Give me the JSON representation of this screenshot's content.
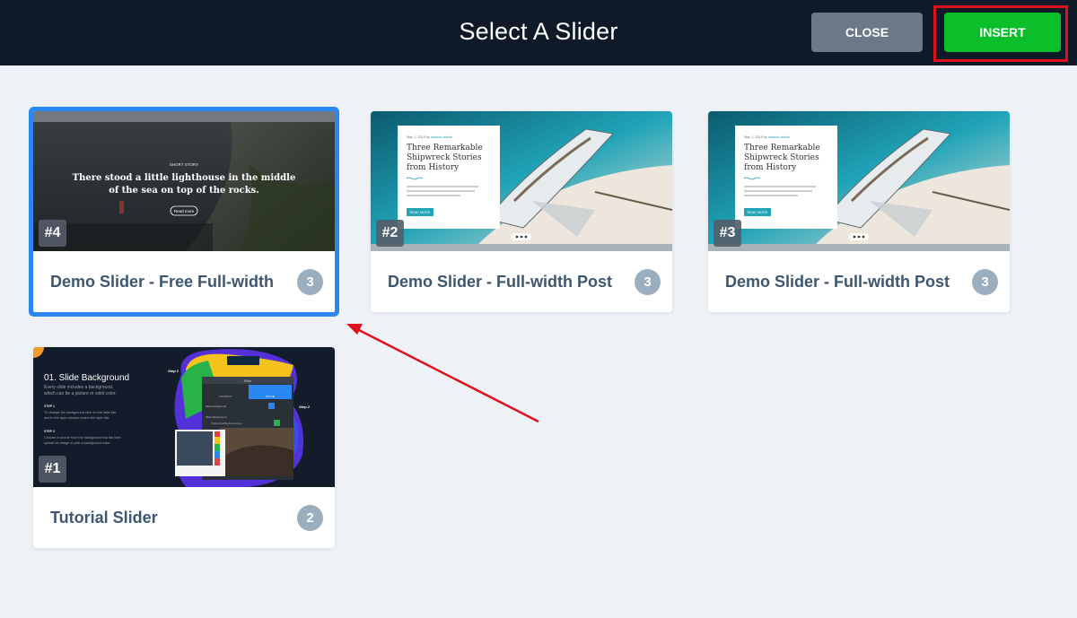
{
  "header": {
    "title": "Select A Slider",
    "close_label": "CLOSE",
    "insert_label": "INSERT"
  },
  "colors": {
    "header_bg": "#0f1a28",
    "close_bg": "#6b7888",
    "insert_bg": "#0bbf2b",
    "highlight_red": "#e0111f",
    "selected_blue": "#2a87f2",
    "page_bg": "#eef2f6"
  },
  "sliders": [
    {
      "number": "#4",
      "name": "Demo Slider - Free Full-width",
      "count": "3",
      "selected": true,
      "thumb": {
        "eyebrow": "SHORT STORY",
        "headline_line1": "There stood a little lighthouse in the middle",
        "headline_line2": "of the sea on top of the rocks.",
        "button": "Read more"
      }
    },
    {
      "number": "#2",
      "name": "Demo Slider - Full-width Post",
      "count": "3",
      "selected": false,
      "thumb": {
        "meta": "May 1, 2019 by ",
        "meta_link": "sample.author",
        "headline_line1": "Three Remarkable",
        "headline_line2": "Shipwreck Stories",
        "headline_line3": "from History",
        "button": "READ MORE"
      }
    },
    {
      "number": "#3",
      "name": "Demo Slider - Full-width Post",
      "count": "3",
      "selected": false,
      "thumb": {
        "meta": "May 1, 2019 by ",
        "meta_link": "sample.author",
        "headline_line1": "Three Remarkable",
        "headline_line2": "Shipwreck Stories",
        "headline_line3": "from History",
        "button": "READ MORE"
      }
    },
    {
      "number": "#1",
      "name": "Tutorial Slider",
      "count": "2",
      "selected": false,
      "thumb": {
        "title": "01. Slide Background",
        "intro_line1": "Every slide includes a background,",
        "intro_line2": "which can be a picture or solid color.",
        "step1_label": "STEP 1",
        "step1_line1": "To change the background click on the label bar",
        "step1_line2": "and in the layer window select the style tab.",
        "step2_label": "STEP 2",
        "step2_line1": "Choose a source from the background top tab then",
        "step2_line2": "upload an image or pick a background color.",
        "callout1": "Step 1",
        "callout2": "Step 2",
        "panel_title": "Slide",
        "panel_tab1": "CONTENT",
        "panel_tab2": "STYLE",
        "panel_row1": "Slide background",
        "panel_row2": "Slide Background",
        "panel_file": "SlideDefaultBackground.jpg"
      }
    }
  ]
}
